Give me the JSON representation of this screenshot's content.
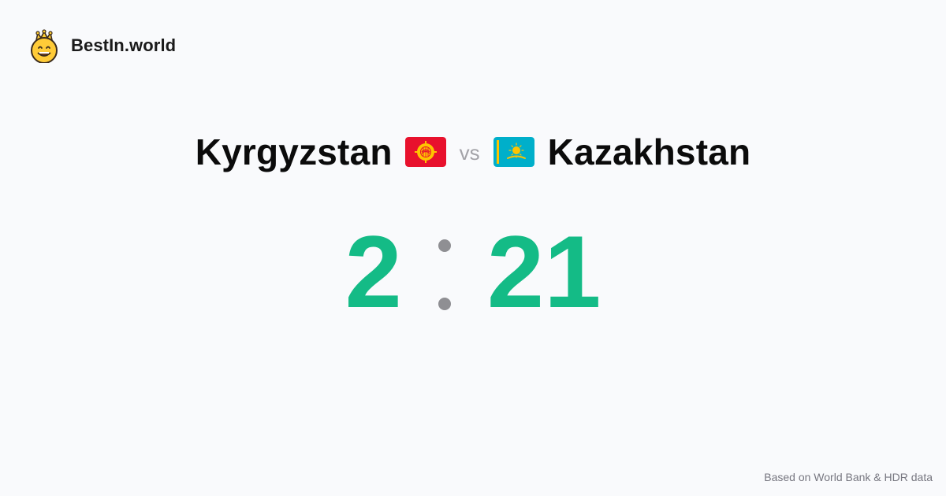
{
  "brand": {
    "name": "BestIn.world",
    "icon": "crowned-smiley-icon"
  },
  "matchup": {
    "left_country": "Kyrgyzstan",
    "left_flag": "kyrgyzstan-flag-icon",
    "vs_label": "vs",
    "right_country": "Kazakhstan",
    "right_flag": "kazakhstan-flag-icon"
  },
  "score": {
    "left": "2",
    "right": "21"
  },
  "footer": {
    "source_text": "Based on World Bank & HDR data"
  },
  "colors": {
    "background": "#f9fafc",
    "score": "#14bb86",
    "separator": "#8f8f93",
    "vs": "#a3a3a8",
    "kyrgyzstan_red": "#e8112d",
    "kazakhstan_blue": "#00afca",
    "gold": "#fec400"
  }
}
